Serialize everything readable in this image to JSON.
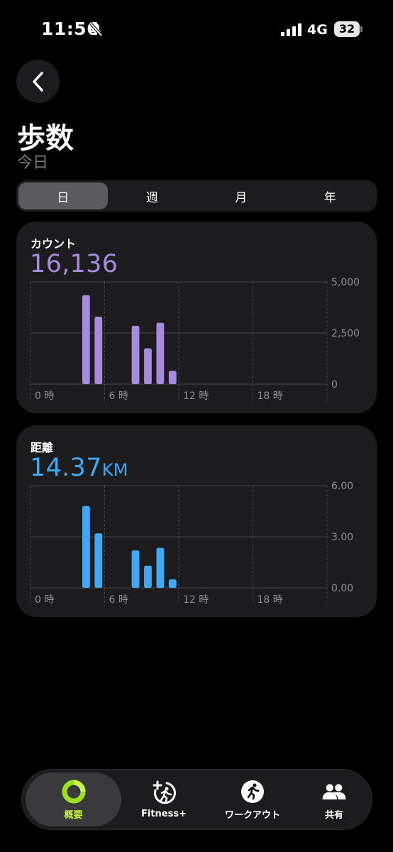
{
  "status_bar": {
    "time": "11:56",
    "network": "4G",
    "battery": "32"
  },
  "header": {
    "title": "歩数",
    "subtitle": "今日"
  },
  "segments": [
    {
      "label": "日",
      "active": true
    },
    {
      "label": "週",
      "active": false
    },
    {
      "label": "月",
      "active": false
    },
    {
      "label": "年",
      "active": false
    }
  ],
  "steps_card": {
    "label": "カウント",
    "value": "16,136"
  },
  "distance_card": {
    "label": "距離",
    "value": "14.37",
    "unit": "KM"
  },
  "chart_data": [
    {
      "type": "bar",
      "x_ticks": [
        "0 時",
        "6 時",
        "12 時",
        "18 時"
      ],
      "x_domain": [
        0,
        24
      ],
      "y_ticks": [
        "0",
        "2,500",
        "5,000"
      ],
      "ylim": [
        0,
        5000
      ],
      "color": "#a78bdc",
      "bars": [
        {
          "hour": 4,
          "value": 4350
        },
        {
          "hour": 5,
          "value": 3300
        },
        {
          "hour": 8,
          "value": 2850
        },
        {
          "hour": 9,
          "value": 1750
        },
        {
          "hour": 10,
          "value": 3000
        },
        {
          "hour": 11,
          "value": 650
        }
      ]
    },
    {
      "type": "bar",
      "x_ticks": [
        "0 時",
        "6 時",
        "12 時",
        "18 時"
      ],
      "x_domain": [
        0,
        24
      ],
      "y_ticks": [
        "0.00",
        "3.00",
        "6.00"
      ],
      "ylim": [
        0,
        6
      ],
      "color": "#3fa9f5",
      "bars": [
        {
          "hour": 4,
          "value": 4.8
        },
        {
          "hour": 5,
          "value": 3.2
        },
        {
          "hour": 8,
          "value": 2.2
        },
        {
          "hour": 9,
          "value": 1.3
        },
        {
          "hour": 10,
          "value": 2.35
        },
        {
          "hour": 11,
          "value": 0.5
        }
      ]
    }
  ],
  "tabbar": {
    "tabs": [
      {
        "label": "概要",
        "icon": "activity-ring-icon",
        "active": true
      },
      {
        "label": "Fitness+",
        "icon": "fitness-plus-icon",
        "active": false
      },
      {
        "label": "ワークアウト",
        "icon": "running-figure-icon",
        "active": false
      },
      {
        "label": "共有",
        "icon": "people-icon",
        "active": false
      }
    ]
  }
}
